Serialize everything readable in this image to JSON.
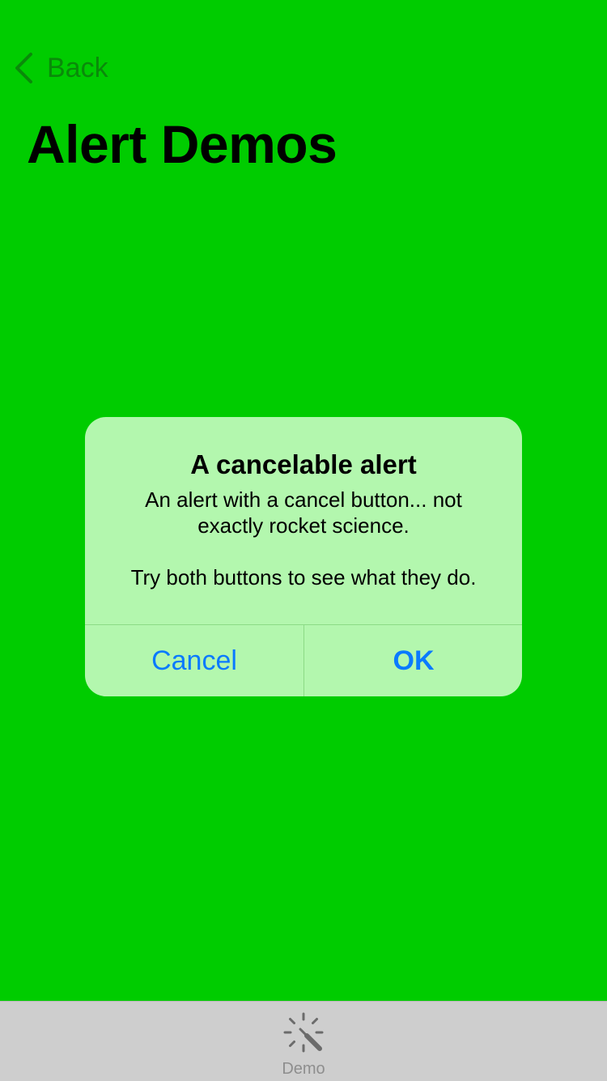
{
  "nav": {
    "back_label": "Back",
    "title": "Alert Demos"
  },
  "alert": {
    "title": "A cancelable alert",
    "message": "An alert with a cancel button... not\nexactly rocket science.\n\nTry both buttons to see what they do.",
    "cancel_label": "Cancel",
    "ok_label": "OK"
  },
  "tabbar": {
    "items": [
      {
        "label": "Demo",
        "icon": "magic-wand-icon"
      }
    ]
  },
  "colors": {
    "background": "#00CC00",
    "alert_background": "#B3F7AE",
    "button_tint": "#0A7AFF",
    "back_tint": "#0A8A0A",
    "tabbar_background": "#CECECE",
    "tab_label": "#8E8E8E"
  }
}
